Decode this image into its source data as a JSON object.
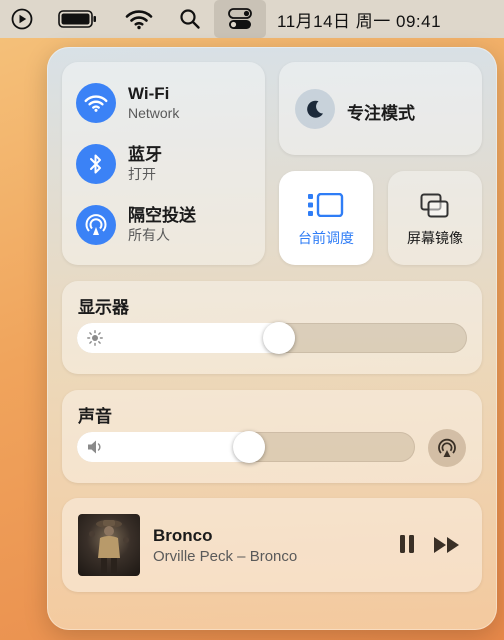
{
  "menubar": {
    "icons": [
      "play-circle-icon",
      "battery-icon",
      "wifi-icon",
      "search-icon",
      "control-center-icon"
    ],
    "clock": "11月14日 周一  09:41"
  },
  "network": {
    "wifi": {
      "title": "Wi-Fi",
      "subtitle": "Network"
    },
    "bluetooth": {
      "title": "蓝牙",
      "subtitle": "打开"
    },
    "airdrop": {
      "title": "隔空投送",
      "subtitle": "所有人"
    }
  },
  "focus": {
    "label": "专注模式"
  },
  "stage_manager": {
    "label": "台前调度",
    "active": true
  },
  "screen_mirroring": {
    "label": "屏幕镜像"
  },
  "display": {
    "title": "显示器",
    "level": 0.52
  },
  "sound": {
    "title": "声音",
    "level": 0.51
  },
  "now_playing": {
    "title": "Bronco",
    "artist": "Orville Peck – Bronco"
  },
  "colors": {
    "accent": "#3b82f6",
    "stage_accent": "#2f7df6"
  }
}
